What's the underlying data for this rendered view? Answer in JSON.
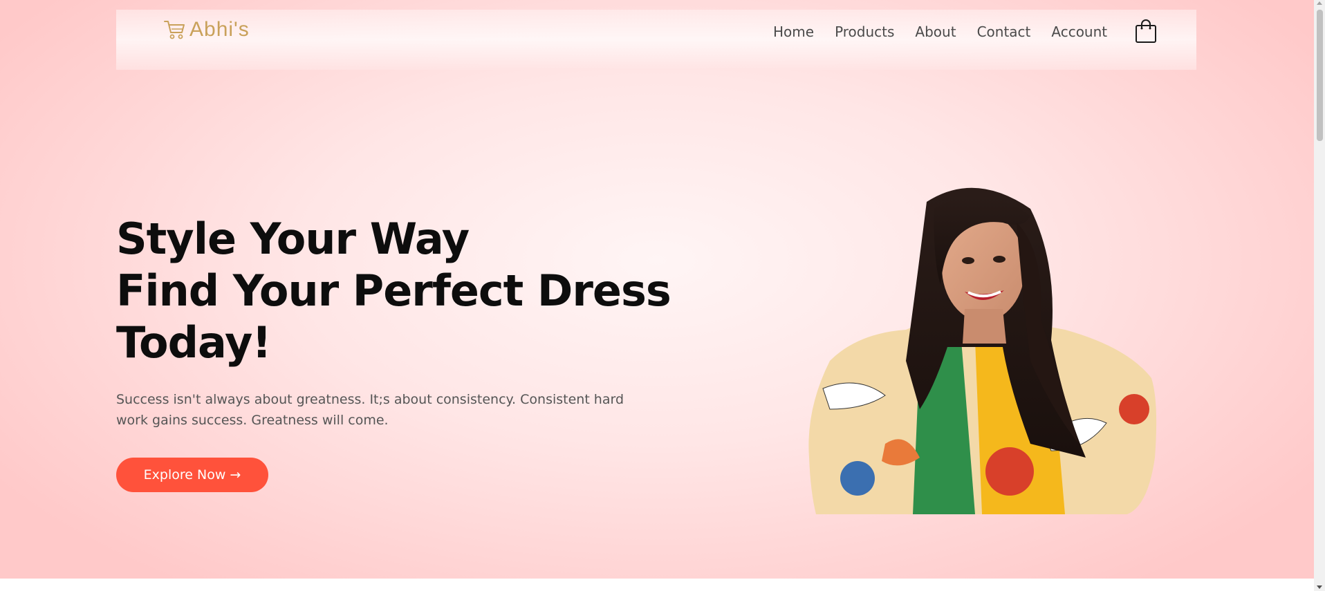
{
  "brand": {
    "logo_text": "Abhi's",
    "logo_icon": "shopping-cart-icon",
    "logo_color": "#c9a15a"
  },
  "nav": {
    "items": [
      {
        "label": "Home"
      },
      {
        "label": "Products"
      },
      {
        "label": "About"
      },
      {
        "label": "Contact"
      },
      {
        "label": "Account"
      }
    ],
    "cart_icon": "shopping-bag-icon"
  },
  "hero": {
    "headline_lines": [
      "Style Your Way",
      "Find Your Perfect Dress",
      "Today!"
    ],
    "subtext": "Success isn't always about greatness. It;s about consistency. Consistent hard work gains success. Greatness will come.",
    "cta_label": "Explore Now →",
    "cta_color": "#ff523b",
    "image_icon": "model-photo"
  }
}
